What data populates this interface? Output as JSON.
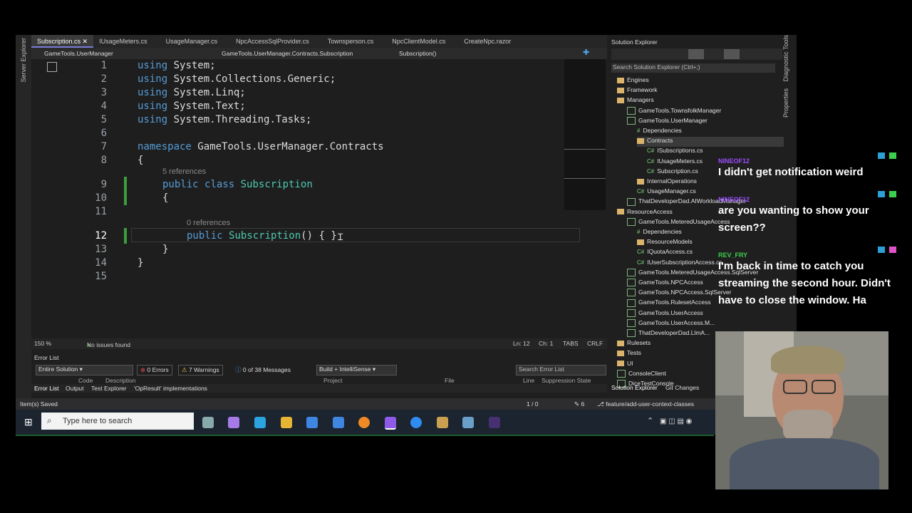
{
  "tabs": [
    {
      "label": "Subscription.cs",
      "active": true
    },
    {
      "label": "IUsageMeters.cs"
    },
    {
      "label": "UsageManager.cs"
    },
    {
      "label": "NpcAccessSqlProvider.cs"
    },
    {
      "label": "Townsperson.cs"
    },
    {
      "label": "NpcClientModel.cs"
    },
    {
      "label": "CreateNpc.razor"
    }
  ],
  "navbar": {
    "project": "GameTools.UserManager",
    "namespace": "GameTools.UserManager.Contracts.Subscription",
    "member": "Subscription()"
  },
  "side_strip": {
    "left": "Server Explorer",
    "right_top": "Diagnostic Tools",
    "right_bottom": "Properties"
  },
  "code": {
    "lines": [
      "1",
      "2",
      "3",
      "4",
      "5",
      "6",
      "7",
      "8",
      "9",
      "10",
      "11",
      "12",
      "13",
      "14",
      "15"
    ],
    "l1": "System;",
    "l2": "System.Collections.Generic;",
    "l3": "System.Linq;",
    "l4": "System.Text;",
    "l5": "System.Threading.Tasks;",
    "using": "using",
    "namespace_kw": "namespace",
    "namespace_name": "GameTools.UserManager.Contracts",
    "refs5": "5 references",
    "refs0": "0 references",
    "public": "public",
    "class": "class",
    "class_name": "Subscription",
    "ctor": "Subscription",
    "ctor_tail": "() { }",
    "brace_open": "{",
    "brace_close": "}"
  },
  "editor_status": {
    "zoom": "150 %",
    "issues": "No issues found",
    "ln": "Ln: 12",
    "ch": "Ch: 1",
    "tabs": "TABS",
    "crlf": "CRLF"
  },
  "error_list": {
    "title": "Error List",
    "scope": "Entire Solution",
    "errors": "0 Errors",
    "warnings": "7 Warnings",
    "messages": "0 of 38 Messages",
    "build": "Build + IntelliSense",
    "search": "Search Error List",
    "cols": [
      "Code",
      "Description",
      "Project",
      "File",
      "Line",
      "Suppression State"
    ],
    "bottom_tabs": [
      "Error List",
      "Output",
      "Test Explorer",
      "'OpResult' implementations"
    ]
  },
  "statusbar": {
    "left": "Item(s) Saved",
    "nav": "1 / 0",
    "edits": "6",
    "branch": "feature/add-user-context-classes"
  },
  "taskbar": {
    "search_placeholder": "Type here to search"
  },
  "solution_explorer": {
    "title": "Solution Explorer",
    "search": "Search Solution Explorer (Ctrl+;)",
    "items": [
      {
        "label": "Engines",
        "kind": "folder"
      },
      {
        "label": "Framework",
        "kind": "folder"
      },
      {
        "label": "Managers",
        "kind": "folder"
      },
      {
        "label": "GameTools.TownsfolkManager",
        "kind": "project"
      },
      {
        "label": "GameTools.UserManager",
        "kind": "project"
      },
      {
        "label": "Dependencies",
        "kind": "dep"
      },
      {
        "label": "Contracts",
        "kind": "folder",
        "selected": true
      },
      {
        "label": "ISubscriptions.cs",
        "kind": "cs"
      },
      {
        "label": "IUsageMeters.cs",
        "kind": "cs"
      },
      {
        "label": "Subscription.cs",
        "kind": "cs"
      },
      {
        "label": "InternalOperations",
        "kind": "folder"
      },
      {
        "label": "UsageManager.cs",
        "kind": "cs"
      },
      {
        "label": "ThatDeveloperDad.AIWorkloadManager",
        "kind": "project"
      },
      {
        "label": "ResourceAccess",
        "kind": "folder"
      },
      {
        "label": "GameTools.MeteredUsageAccess",
        "kind": "project"
      },
      {
        "label": "Dependencies",
        "kind": "dep"
      },
      {
        "label": "ResourceModels",
        "kind": "folder"
      },
      {
        "label": "IQuotaAccess.cs",
        "kind": "cs"
      },
      {
        "label": "IUserSubscriptionAccess.cs",
        "kind": "cs"
      },
      {
        "label": "GameTools.MeteredUsageAccess.SqlServer",
        "kind": "project"
      },
      {
        "label": "GameTools.NPCAccess",
        "kind": "project"
      },
      {
        "label": "GameTools.NPCAccess.SqlServer",
        "kind": "project"
      },
      {
        "label": "GameTools.RulesetAccess",
        "kind": "project"
      },
      {
        "label": "GameTools.UserAccess",
        "kind": "project"
      },
      {
        "label": "GameTools.UserAccess.M...",
        "kind": "project"
      },
      {
        "label": "ThatDeveloperDad.LlmA...",
        "kind": "project"
      },
      {
        "label": "Rulesets",
        "kind": "folder"
      },
      {
        "label": "Tests",
        "kind": "folder"
      },
      {
        "label": "UI",
        "kind": "folder"
      },
      {
        "label": "ConsoleClient",
        "kind": "project"
      },
      {
        "label": "DiceTestConsole",
        "kind": "project"
      }
    ],
    "bottom_tabs": [
      "Solution Explorer",
      "Git Changes"
    ]
  },
  "chat": [
    {
      "user": "NINEOF12",
      "color": "#9b4dff",
      "text": "I didn't get notification weird"
    },
    {
      "user": "NINEOF12",
      "color": "#9b4dff",
      "text": "are you wanting to show your screen??"
    },
    {
      "user": "REV_FRY",
      "color": "#3ccf4e",
      "text": "I'm back in time to catch you streaming the second hour. Didn't have to close the window. Ha"
    }
  ],
  "colors": {
    "accent": "#7a7ad8",
    "keyword": "#569cd6",
    "type": "#4ec9b0"
  }
}
